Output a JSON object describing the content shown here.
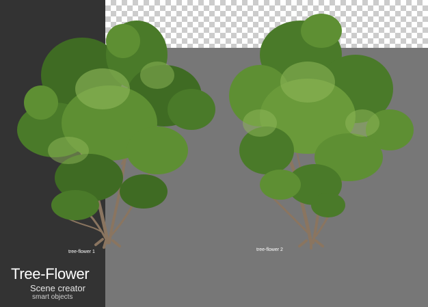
{
  "labels": {
    "tree1": "tree-flower 1",
    "tree2": "tree-flower 2"
  },
  "branding": {
    "title": "Tree-Flower",
    "subtitle": "Scene creator",
    "tagline": "smart objects"
  },
  "colors": {
    "dark_panel": "#333333",
    "gray_background": "#777777",
    "foliage_dark": "#3f6b23",
    "foliage_mid": "#5e8f33",
    "foliage_light": "#8fb85a",
    "trunk": "#8a7560"
  }
}
